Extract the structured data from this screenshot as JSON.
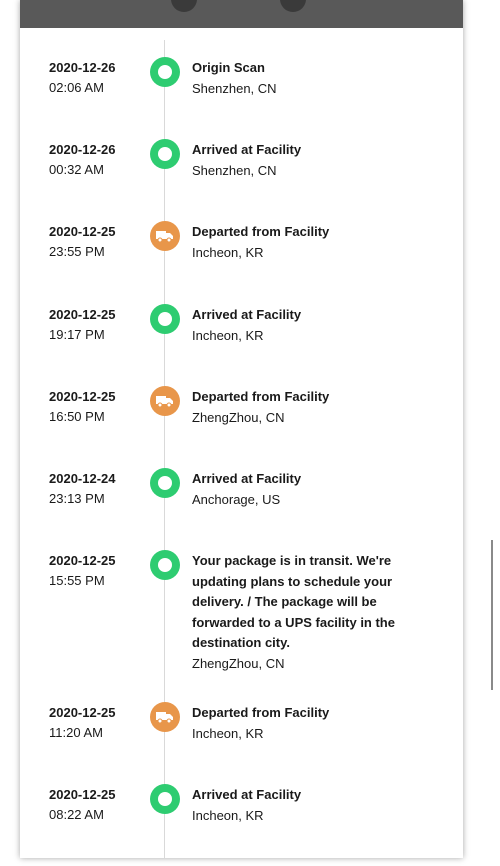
{
  "colors": {
    "delivered_green": "#2ecc71",
    "transit_orange": "#e8964a",
    "text": "#1a1a1a",
    "header_bar": "#595959"
  },
  "events": [
    {
      "date": "2020-12-26",
      "time": "02:06 AM",
      "title": "Origin Scan",
      "location": "Shenzhen, CN",
      "icon": "status-dot-icon"
    },
    {
      "date": "2020-12-26",
      "time": "00:32 AM",
      "title": "Arrived at Facility",
      "location": "Shenzhen, CN",
      "icon": "status-dot-icon"
    },
    {
      "date": "2020-12-25",
      "time": "23:55 PM",
      "title": "Departed from Facility",
      "location": "Incheon, KR",
      "icon": "truck-icon"
    },
    {
      "date": "2020-12-25",
      "time": "19:17 PM",
      "title": "Arrived at Facility",
      "location": "Incheon, KR",
      "icon": "status-dot-icon"
    },
    {
      "date": "2020-12-25",
      "time": "16:50 PM",
      "title": "Departed from Facility",
      "location": "ZhengZhou, CN",
      "icon": "truck-icon"
    },
    {
      "date": "2020-12-24",
      "time": "23:13 PM",
      "title": "Arrived at Facility",
      "location": "Anchorage, US",
      "icon": "status-dot-icon"
    },
    {
      "date": "2020-12-25",
      "time": "15:55 PM",
      "title": "Your package is in transit. We're updating plans to schedule your delivery. / The package will be forwarded to a UPS facility in the destination city.",
      "location": "ZhengZhou, CN",
      "icon": "status-dot-icon"
    },
    {
      "date": "2020-12-25",
      "time": "11:20 AM",
      "title": "Departed from Facility",
      "location": "Incheon, KR",
      "icon": "truck-icon"
    },
    {
      "date": "2020-12-25",
      "time": "08:22 AM",
      "title": "Arrived at Facility",
      "location": "Incheon, KR",
      "icon": "status-dot-icon"
    }
  ]
}
